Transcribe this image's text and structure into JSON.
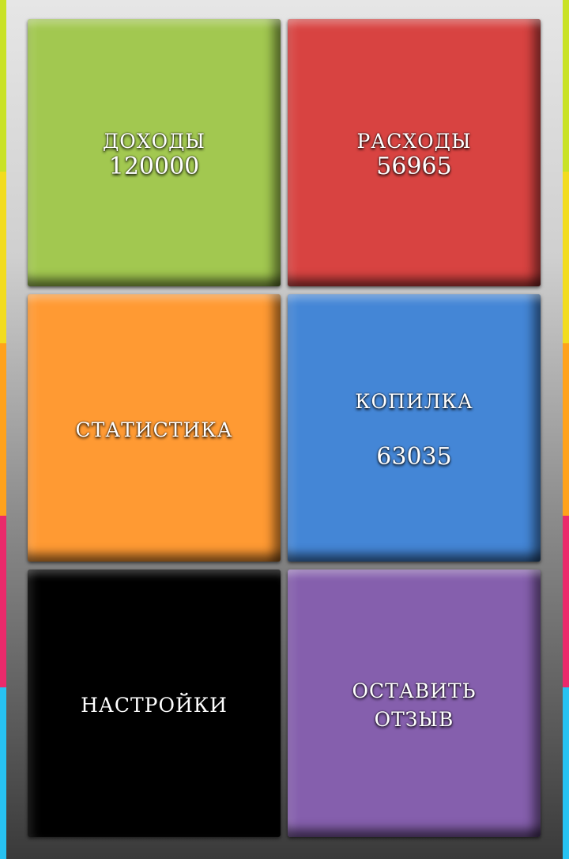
{
  "tiles": {
    "income": {
      "label": "Доходы",
      "value": "120000",
      "color": "#a2c850"
    },
    "expenses": {
      "label": "Расходы",
      "value": "56965",
      "color": "#d84341"
    },
    "stats": {
      "label": "Статистика",
      "color": "#ff9a33"
    },
    "piggy": {
      "label": "Копилка",
      "value": "63035",
      "color": "#4486d6"
    },
    "settings": {
      "label": "Настройки",
      "color": "#000000"
    },
    "feedback": {
      "label_line1": "Оставить",
      "label_line2": "отзыв",
      "color": "#855fad"
    }
  },
  "edge_colors": [
    "#c9e226",
    "#f2dc1f",
    "#ffa21c",
    "#ea2a6b",
    "#27c2f2"
  ]
}
